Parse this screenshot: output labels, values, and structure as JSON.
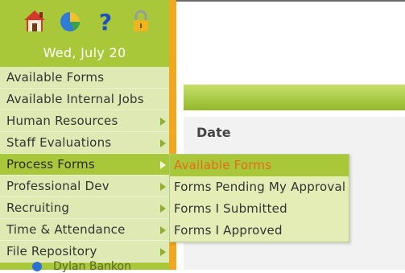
{
  "sidebar": {
    "icons": [
      "home-icon",
      "chart-pie-icon",
      "help-icon",
      "lock-icon"
    ],
    "date": "Wed, July 20",
    "items": [
      {
        "label": "Available Forms",
        "has_submenu": false
      },
      {
        "label": "Available Internal Jobs",
        "has_submenu": false
      },
      {
        "label": "Human Resources",
        "has_submenu": true
      },
      {
        "label": "Staff Evaluations",
        "has_submenu": true
      },
      {
        "label": "Process Forms",
        "has_submenu": true,
        "active": true
      },
      {
        "label": "Professional Dev",
        "has_submenu": true
      },
      {
        "label": "Recruiting",
        "has_submenu": true
      },
      {
        "label": "Time & Attendance",
        "has_submenu": true
      },
      {
        "label": "File Repository",
        "has_submenu": true
      }
    ],
    "user_name": "Dylan Bankon"
  },
  "main": {
    "column_header": "Date"
  },
  "flyout": {
    "items": [
      {
        "label": "Available Forms",
        "active": true
      },
      {
        "label": "Forms Pending My Approval"
      },
      {
        "label": "Forms I Submitted"
      },
      {
        "label": "Forms I Approved"
      }
    ]
  },
  "colors": {
    "sidebar": "#a8c83a",
    "menu_item": "#dfe9b3",
    "accent_edge": "#f0a81e",
    "active_flyout_text": "#e86a17"
  }
}
